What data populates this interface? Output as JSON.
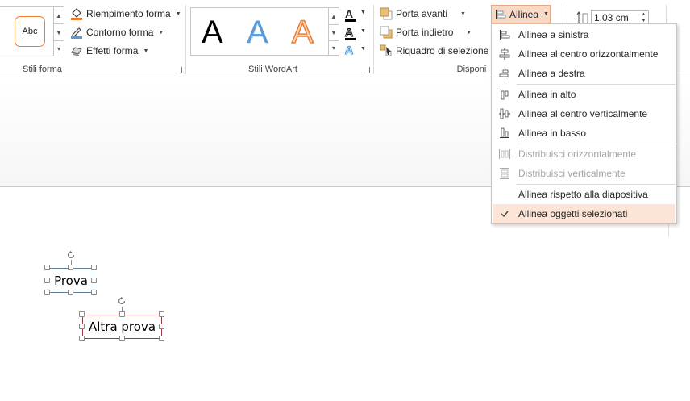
{
  "ribbon": {
    "shape_styles": {
      "swatch_label": "Abc",
      "fill_label": "Riempimento forma",
      "outline_label": "Contorno forma",
      "effects_label": "Effetti forma",
      "group_label": "Stili forma"
    },
    "wordart": {
      "letter": "A",
      "group_label": "Stili WordArt"
    },
    "arrange": {
      "bring_forward": "Porta avanti",
      "send_backward": "Porta indietro",
      "selection_pane": "Riquadro di selezione",
      "align_label": "Allinea",
      "group_label": "Disponi"
    },
    "size": {
      "height_value": "1,03 cm"
    }
  },
  "align_menu": {
    "items": [
      {
        "label": "Allinea a sinistra",
        "icon": "align-left-icon",
        "disabled": false,
        "checked": false
      },
      {
        "label": "Allinea al centro orizzontalmente",
        "icon": "align-center-icon",
        "disabled": false,
        "checked": false
      },
      {
        "label": "Allinea a destra",
        "icon": "align-right-icon",
        "disabled": false,
        "checked": false
      },
      {
        "label": "Allinea in alto",
        "icon": "align-top-icon",
        "disabled": false,
        "checked": false
      },
      {
        "label": "Allinea al centro verticalmente",
        "icon": "align-middle-icon",
        "disabled": false,
        "checked": false
      },
      {
        "label": "Allinea in basso",
        "icon": "align-bottom-icon",
        "disabled": false,
        "checked": false
      },
      {
        "label": "Distribuisci orizzontalmente",
        "icon": "distribute-horizontal-icon",
        "disabled": true,
        "checked": false
      },
      {
        "label": "Distribuisci verticalmente",
        "icon": "distribute-vertical-icon",
        "disabled": true,
        "checked": false
      },
      {
        "label": "Allinea rispetto alla diapositiva",
        "icon": "",
        "disabled": false,
        "checked": false
      },
      {
        "label": "Allinea oggetti selezionati",
        "icon": "checkmark-icon",
        "disabled": false,
        "checked": true
      }
    ]
  },
  "slide": {
    "shape1_text": "Prova",
    "shape2_text": "Altra prova"
  },
  "colors": {
    "accent_orange": "#ed7d31",
    "wordart_blue": "#5b9bd5",
    "menu_highlight": "#fce4d6"
  }
}
